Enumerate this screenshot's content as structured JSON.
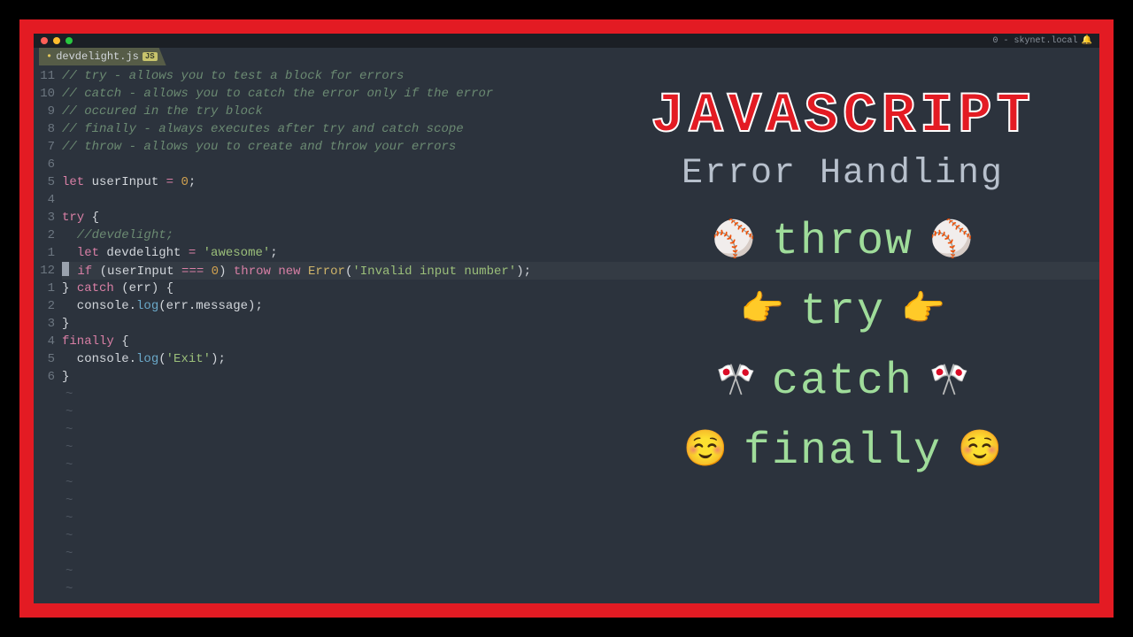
{
  "titlebar": {
    "traffic": [
      "#ff5f57",
      "#febc2e",
      "#28c840"
    ],
    "status": "0 - skynet.local"
  },
  "tab": {
    "modified_marker": "•",
    "filename": "devdelight.js",
    "badge": "JS"
  },
  "gutter": [
    "11",
    "10",
    "9",
    "8",
    "7",
    "6",
    "5",
    "4",
    "3",
    "2",
    "1",
    "12",
    "1",
    "2",
    "3",
    "4",
    "5",
    "6"
  ],
  "code": {
    "l1": "// try - allows you to test a block for errors",
    "l2": "// catch - allows you to catch the error only if the error",
    "l3": "// occured in the try block",
    "l4": "// finally - always executes after try and catch scope",
    "l5": "// throw - allows you to create and throw your errors",
    "l7_let": "let",
    "l7_var": " userInput ",
    "l7_eq": "=",
    "l7_sp": " ",
    "l7_num": "0",
    "l7_semi": ";",
    "l9_try": "try",
    "l9_brace": " {",
    "l10_c": "  //devdelight;",
    "l11_let": "  let",
    "l11_var": " devdelight ",
    "l11_eq": "=",
    "l11_sp": " ",
    "l11_str": "'awesome'",
    "l11_semi": ";",
    "l12_pre": " ",
    "l12_if": "if",
    "l12_sp1": " (userInput ",
    "l12_eq": "===",
    "l12_sp2": " ",
    "l12_num": "0",
    "l12_cp": ") ",
    "l12_throw": "throw",
    "l12_sp3": " ",
    "l12_new": "new",
    "l12_sp4": " ",
    "l12_err": "Error",
    "l12_op": "(",
    "l12_str": "'Invalid input number'",
    "l12_end": ");",
    "l13_a": "} ",
    "l13_catch": "catch",
    "l13_b": " (err) {",
    "l14_a": "  console.",
    "l14_log": "log",
    "l14_b": "(err.message);",
    "l15": "}",
    "l16_fin": "finally",
    "l16_b": " {",
    "l17_a": "  console.",
    "l17_log": "log",
    "l17_b": "(",
    "l17_str": "'Exit'",
    "l17_c": ");",
    "l18": "}",
    "tilde": "~"
  },
  "overlay": {
    "title": "JAVASCRIPT",
    "subtitle": "Error Handling",
    "items": [
      {
        "emoji": "⚾",
        "label": "throw"
      },
      {
        "emoji": "👉",
        "label": "try"
      },
      {
        "emoji": "🎌",
        "label": "catch"
      },
      {
        "emoji": "☺️",
        "label": "finally"
      }
    ]
  }
}
